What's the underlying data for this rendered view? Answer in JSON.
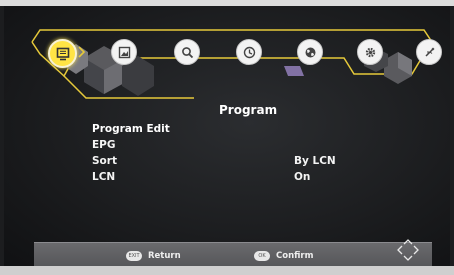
{
  "menu": {
    "title": "Program",
    "items": [
      {
        "label": "Program Edit",
        "value": ""
      },
      {
        "label": "EPG",
        "value": ""
      },
      {
        "label": "Sort",
        "value": "By LCN"
      },
      {
        "label": "LCN",
        "value": "On"
      }
    ]
  },
  "tabs": [
    {
      "icon": "tv-icon",
      "active": true
    },
    {
      "icon": "picture-icon",
      "active": false
    },
    {
      "icon": "search-icon",
      "active": false
    },
    {
      "icon": "clock-icon",
      "active": false
    },
    {
      "icon": "globe-icon",
      "active": false
    },
    {
      "icon": "gear-icon",
      "active": false
    },
    {
      "icon": "usb-icon",
      "active": false
    }
  ],
  "footer": {
    "return_label": "Return",
    "confirm_label": "Confirm",
    "return_key": "EXIT",
    "confirm_key": "OK"
  },
  "colors": {
    "accent": "#ffe445",
    "text": "#f4f4f4",
    "background": "#1c1d1f",
    "footer": "#5e5f62"
  }
}
